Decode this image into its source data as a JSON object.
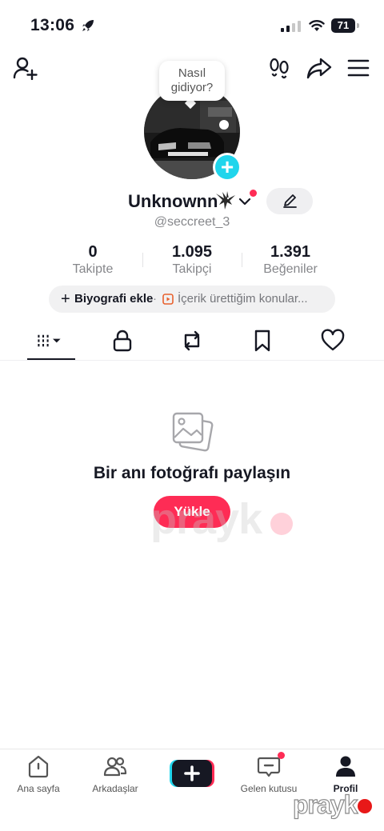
{
  "status_bar": {
    "time": "13:06",
    "battery": "71"
  },
  "profile": {
    "bubble_text": "Nasıl gidiyor?",
    "display_name": "Unknownn",
    "handle": "@seccreet_3",
    "stats": [
      {
        "value": "0",
        "label": "Takipte"
      },
      {
        "value": "1.095",
        "label": "Takipçi"
      },
      {
        "value": "1.391",
        "label": "Beğeniler"
      }
    ],
    "bio_add_plus": "+",
    "bio_add_label": "Biyografi ekle",
    "bio_separator": "·",
    "bio_topics": "İçerik ürettiğim konular..."
  },
  "tabs": [
    "videos-grid",
    "private-lock",
    "reposts",
    "favorites-bookmark",
    "liked-heart"
  ],
  "empty_state": {
    "title": "Bir anı fotoğrafı paylaşın",
    "upload_label": "Yükle"
  },
  "watermark": {
    "text": "prayk"
  },
  "bottom_nav": {
    "home": "Ana sayfa",
    "friends": "Arkadaşlar",
    "inbox": "Gelen kutusu",
    "profile": "Profil"
  },
  "colors": {
    "accent": "#fe2c55",
    "cyan": "#20d5ec",
    "text": "#161823",
    "muted": "#86878b"
  }
}
